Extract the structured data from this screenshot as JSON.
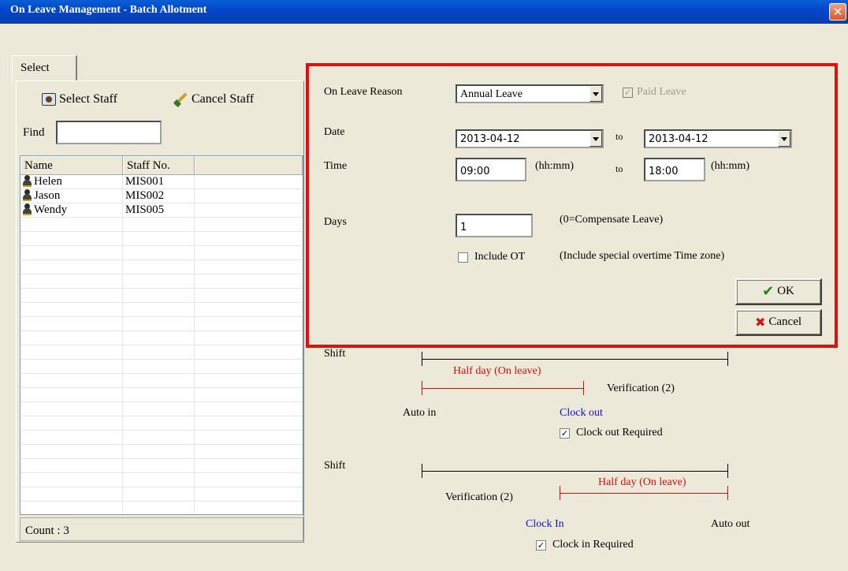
{
  "window": {
    "title": "On Leave Management - Batch Allotment",
    "close_label": "✕"
  },
  "left": {
    "tab_label": "Select",
    "select_staff_label": "Select Staff",
    "cancel_staff_label": "Cancel Staff",
    "find_label": "Find",
    "find_value": "",
    "columns": [
      "Name",
      "Staff No."
    ],
    "rows": [
      {
        "name": "Helen",
        "staff_no": "MIS001"
      },
      {
        "name": "Jason",
        "staff_no": "MIS002"
      },
      {
        "name": "Wendy",
        "staff_no": "MIS005"
      }
    ],
    "count_text": "Count : 3"
  },
  "form": {
    "reason_label": "On Leave Reason",
    "reason_value": "Annual Leave",
    "paid_leave_label": "Paid Leave",
    "paid_leave_checked": true,
    "date_label": "Date",
    "date_from": "2013-04-12",
    "to_label": "to",
    "date_to": "2013-04-12",
    "time_label": "Time",
    "time_from": "09:00",
    "time_unit": "(hh:mm)",
    "time_to": "18:00",
    "days_label": "Days",
    "days_value": "1",
    "days_note": "(0=Compensate Leave)",
    "include_ot_label": "Include OT",
    "include_ot_checked": false,
    "ot_note": "(Include special overtime Time zone)",
    "ok_label": "OK",
    "cancel_label": "Cancel"
  },
  "diagram1": {
    "shift_label": "Shift",
    "half_day_label": "Half day (On leave)",
    "verification_label": "Verification (2)",
    "auto_in_label": "Auto in",
    "clock_out_label": "Clock out",
    "clock_out_required_label": "Clock out Required",
    "clock_out_required_checked": true
  },
  "diagram2": {
    "shift_label": "Shift",
    "half_day_label": "Half day (On leave)",
    "verification_label": "Verification (2)",
    "clock_in_label": "Clock In",
    "auto_out_label": "Auto out",
    "clock_in_required_label": "Clock in Required",
    "clock_in_required_checked": true
  },
  "colors": {
    "title_bar": "#0046c8",
    "highlight_box": "#e01010",
    "leave_segment": "#d01010",
    "clock_label": "#1010d0"
  }
}
